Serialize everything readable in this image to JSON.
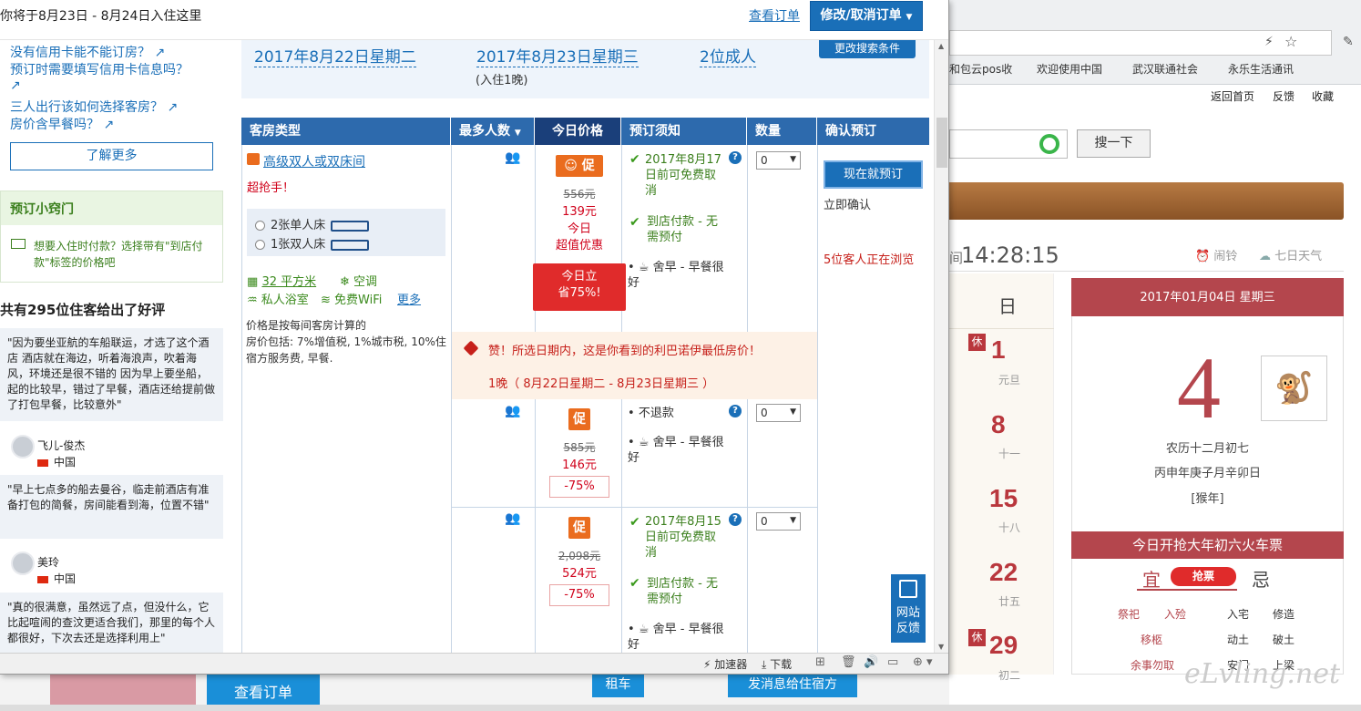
{
  "popup": {
    "title": "你将于8月23日 - 8月24日入住这里",
    "view_order": "查看订单",
    "modify_order": "修改/取消订单"
  },
  "left": {
    "questions": [
      "没有信用卡能不能订房？",
      "预订时需要填写信用卡信息吗？",
      "三人出行该如何选择客房？",
      "房价含早餐吗？"
    ],
    "learn_more": "了解更多",
    "tips_title": "预订小窍门",
    "tips_body": "想要入住时付款？选择带有\"到店付款\"标签的价格吧",
    "reviews_title": "共有295位住客给出了好评",
    "reviews": [
      {
        "text": "\"因为要坐亚航的车船联运，才选了这个酒店 酒店就在海边，听着海浪声，吹着海风，环境还是很不错的 因为早上要坐船，起的比较早，错过了早餐，酒店还给提前做了打包早餐，比较意外\"",
        "user": "飞儿-俊杰",
        "country": "中国"
      },
      {
        "text": "\"早上七点多的船去曼谷，临走前酒店有准备打包的简餐，房间能看到海，位置不错\"",
        "user": "美玲",
        "country": "中国"
      },
      {
        "text": "\"真的很满意，虽然远了点，但没什么，它比起喧闹的查汶更适合我们，那里的每个人都很好，下次去还是选择利用上\""
      }
    ]
  },
  "search": {
    "checkin": "2017年8月22日星期二",
    "checkout": "2017年8月23日星期三",
    "nights": "(入住1晚)",
    "guests": "2位成人",
    "change": "更改搜索条件"
  },
  "table": {
    "headers": [
      "客房类型",
      "最多人数",
      "今日价格",
      "预订须知",
      "数量",
      "确认预订"
    ],
    "room_name": "高级双人或双床间",
    "hot": "超抢手！",
    "beds": [
      "2张单人床",
      "1张双人床"
    ],
    "area": "32 平方米",
    "aircon": "空调",
    "bath": "私人浴室",
    "wifi": "免费WiFi",
    "more": "更多",
    "price_note": "价格是按每间客房计算的\n房价包括: 7%增值税, 1%城市税, 10%住宿方服务费, 早餐.",
    "book_now": "现在就预订",
    "instant": "立即确认",
    "browsing": "5位客人正在浏览",
    "deal_line1": "赞！所选日期内，这是你看到的利巴诺伊最低房价！",
    "deal_line2": "1晚（ 8月22日星期二 - 8月23日星期三 ）",
    "rows": [
      {
        "promo": "促",
        "old": "556元",
        "new": "139元",
        "deal": "今日\n超值优惠",
        "save": "今日立\n省75%!",
        "policy": [
          "2017年8月17日前可免费取消",
          "到店付款 - 无需预付",
          "舍早 - 早餐很好"
        ],
        "qty": "0"
      },
      {
        "promo": "促",
        "old": "585元",
        "new": "146元",
        "pct": "-75%",
        "policy": [
          "不退款",
          "舍早 - 早餐很好"
        ],
        "qty": "0"
      },
      {
        "promo": "促",
        "old": "2,098元",
        "new": "524元",
        "pct": "-75%",
        "policy": [
          "2017年8月15日前可免费取消",
          "到店付款 - 无需预付",
          "舍早 - 早餐很好"
        ],
        "qty": "0"
      }
    ],
    "feedback": "网站反馈"
  },
  "statusbar": {
    "accelerator": "加速器",
    "download": "下载"
  },
  "bottom": {
    "view_order": "查看订单",
    "car": "租车",
    "send_info": "发消息给住宿方"
  },
  "background": {
    "bookmarks": [
      "和包云pos收",
      "欢迎使用中国",
      "武汉联通社会",
      "永乐生活通讯"
    ],
    "links": [
      "返回首页",
      "反馈",
      "收藏"
    ],
    "search_btn": "搜一下",
    "clock": "14:28:15",
    "alarm": "闹铃",
    "weather": "七日天气",
    "weekday": "日",
    "days": [
      {
        "d": "1",
        "s": "元旦"
      },
      {
        "d": "8",
        "s": "十一"
      },
      {
        "d": "15",
        "s": "十八"
      },
      {
        "d": "22",
        "s": "廿五"
      },
      {
        "d": "29",
        "s": "初二"
      }
    ],
    "rest": "休",
    "cal_date": "2017年01月04日 星期三",
    "cal_day": "4",
    "lunar": "农历十二月初七",
    "ganzhi": "丙申年庚子月辛卯日",
    "zodiac": "[猴年]",
    "ticket": "今日开抢大年初六火车票",
    "yi": "宜",
    "grab": "抢票",
    "ji": "忌",
    "yi_items": [
      "祭祀",
      "入殓",
      "移柩",
      "余事勿取"
    ],
    "ji_items": [
      "入宅",
      "修造",
      "动土",
      "破土",
      "安门",
      "上梁"
    ],
    "watermark": "eLvling.net"
  }
}
